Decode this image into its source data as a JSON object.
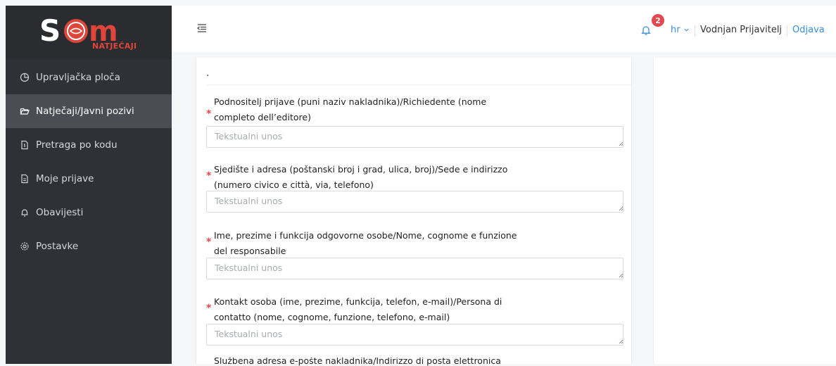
{
  "app": {
    "logo_sub": "NATJEČAJI",
    "brand_color": "#e0453a"
  },
  "sidebar": {
    "items": [
      {
        "label": "Upravljačka ploča",
        "icon": "pie-chart-icon",
        "active": false
      },
      {
        "label": "Natječaji/Javni pozivi",
        "icon": "folder-open-icon",
        "active": true
      },
      {
        "label": "Pretraga po kodu",
        "icon": "document-search-icon",
        "active": false
      },
      {
        "label": "Moje prijave",
        "icon": "document-icon",
        "active": false
      },
      {
        "label": "Obavijesti",
        "icon": "bell-icon",
        "active": false
      },
      {
        "label": "Postavke",
        "icon": "gear-icon",
        "active": false
      }
    ]
  },
  "header": {
    "notification_count": "2",
    "language": "hr",
    "user_name": "Vodnjan Prijavitelj",
    "logout_label": "Odjava",
    "accent_color": "#3a8fd9"
  },
  "form": {
    "top_marker": ".",
    "fields": [
      {
        "label_line1": "Podnositelj prijave (puni naziv nakladnika)/Richiedente (nome",
        "label_line2": "completo dell’editore)",
        "placeholder": "Tekstualni unos",
        "required": true
      },
      {
        "label_line1": "Sjedište i adresa (poštanski broj i grad, ulica, broj)/Sede e indirizzo",
        "label_line2": "(numero civico e città, via, telefono)",
        "placeholder": "Tekstualni unos",
        "required": true
      },
      {
        "label_line1": "Ime, prezime i funkcija odgovorne osobe/Nome, cognome e funzione",
        "label_line2": "del responsabile",
        "placeholder": "Tekstualni unos",
        "required": true
      },
      {
        "label_line1": "Kontakt osoba (ime, prezime, funkcija, telefon, e-mail)/Persona di",
        "label_line2": "contatto (nome, cognome, funzione, telefono, e-mail)",
        "placeholder": "Tekstualni unos",
        "required": true
      },
      {
        "label_line1": "Službena adresa e-pošte nakladnika/Indirizzo di posta elettronica",
        "required": true
      }
    ]
  }
}
